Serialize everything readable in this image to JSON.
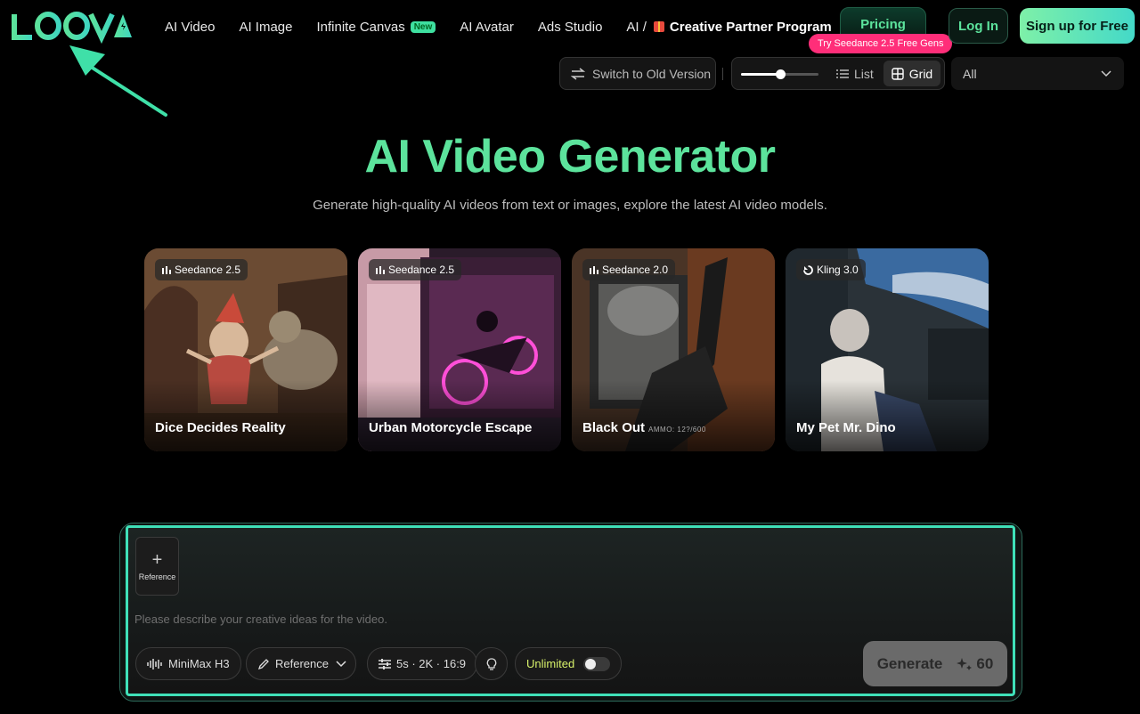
{
  "brand": {
    "logo_text": "LOOVA",
    "accent": "#5ce39c",
    "promo_color": "#ff2e79"
  },
  "nav": {
    "items": [
      {
        "label": "AI Video"
      },
      {
        "label": "AI Image"
      },
      {
        "label": "Infinite Canvas",
        "badge": "New"
      },
      {
        "label": "AI Avatar"
      },
      {
        "label": "Ads Studio"
      },
      {
        "label": "AI /"
      }
    ],
    "creative_partner": "Creative Partner Program",
    "pricing": "Pricing",
    "promo": "Try Seedance 2.5 Free Gens",
    "login": "Log In",
    "signup": "Sign up for Free"
  },
  "toolbar": {
    "switch_label": "Switch to Old Version",
    "zoom_level": 0.5,
    "view_list": "List",
    "view_grid": "Grid",
    "active_view": "grid",
    "filter_value": "All"
  },
  "hero": {
    "title": "AI Video Generator",
    "subtitle": "Generate high-quality AI videos from text or images, explore the latest AI video models."
  },
  "cards": [
    {
      "model": "Seedance 2.5",
      "model_icon": "bars-icon",
      "title": "Dice Decides Reality"
    },
    {
      "model": "Seedance 2.5",
      "model_icon": "bars-icon",
      "title": "Urban Motorcycle Escape"
    },
    {
      "model": "Seedance 2.0",
      "model_icon": "bars-icon",
      "title": "Black Out",
      "overlay_text": "AMMO: 12?/600"
    },
    {
      "model": "Kling 3.0",
      "model_icon": "kling-icon",
      "title": "My Pet Mr. Dino"
    }
  ],
  "prompt": {
    "reference_tile": "Reference",
    "placeholder": "Please describe your creative ideas for the video.",
    "value": "",
    "model_chip": "MiniMax H3",
    "reference_chip": "Reference",
    "settings_chip": "5s · 2K · 16:9",
    "unlimited_label": "Unlimited",
    "unlimited_on": false,
    "generate_label": "Generate",
    "generate_cost": "60"
  }
}
